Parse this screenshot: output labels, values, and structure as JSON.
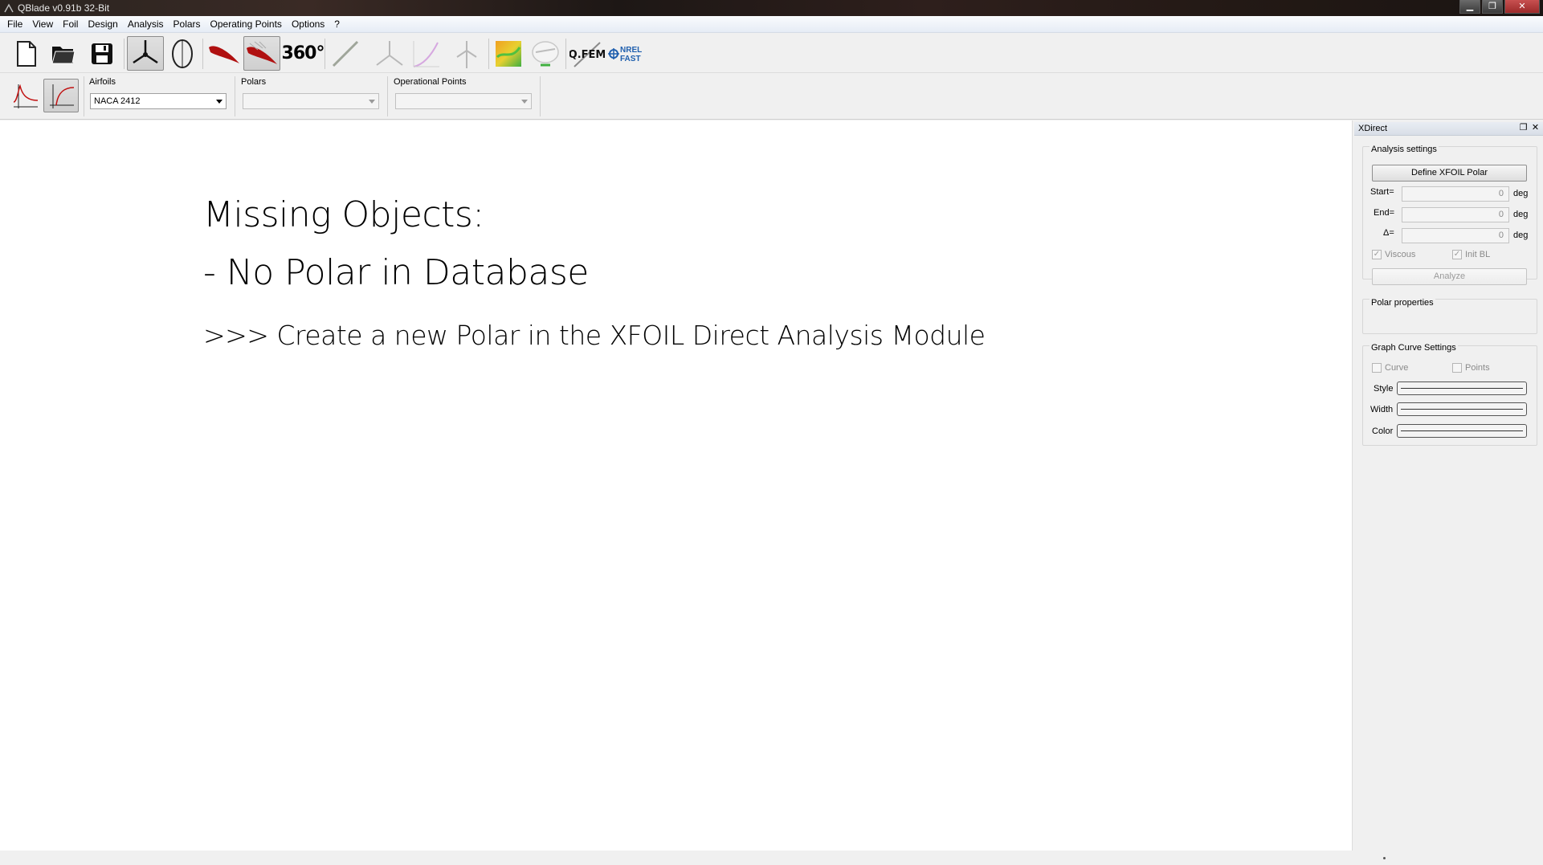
{
  "window": {
    "title": "QBlade v0.91b 32-Bit",
    "controls": [
      "minimize",
      "maximize",
      "close"
    ]
  },
  "menu": [
    "File",
    "View",
    "Foil",
    "Design",
    "Analysis",
    "Polars",
    "Operating Points",
    "Options",
    "?"
  ],
  "toolbar": {
    "items": [
      {
        "name": "new-file-icon"
      },
      {
        "name": "open-folder-icon"
      },
      {
        "name": "save-icon"
      },
      {
        "name": "hawt-rotor-icon",
        "active": true
      },
      {
        "name": "vawt-rotor-icon"
      },
      {
        "name": "airfoil-design-icon"
      },
      {
        "name": "xfoil-direct-icon",
        "active": true
      },
      {
        "name": "polar-360-icon",
        "label": "360°"
      },
      {
        "name": "blade-design-icon"
      },
      {
        "name": "rotor-simulation-icon"
      },
      {
        "name": "multi-parameter-icon"
      },
      {
        "name": "turbine-icon"
      },
      {
        "name": "field-view-icon"
      },
      {
        "name": "characteristic-icon"
      },
      {
        "name": "qfem-icon",
        "label": "Q.FEM"
      },
      {
        "name": "nrel-fast-icon",
        "label_top": "NREL",
        "label_bottom": "FAST"
      }
    ]
  },
  "selectors": {
    "view_buttons": [
      {
        "name": "polar-graph-view-icon"
      },
      {
        "name": "opp-graph-view-icon",
        "active": true
      }
    ],
    "airfoils": {
      "label": "Airfoils",
      "value": "NACA 2412"
    },
    "polars": {
      "label": "Polars",
      "value": ""
    },
    "oppoints": {
      "label": "Operational Points",
      "value": ""
    }
  },
  "message": {
    "line1": "Missing Objects:",
    "line2": "- No Polar in Database",
    "line3": ">>> Create a new Polar in the XFOIL Direct Analysis Module"
  },
  "dock": {
    "title": "XDirect",
    "analysis": {
      "title": "Analysis settings",
      "define_button": "Define XFOIL Polar",
      "start_label": "Start=",
      "start_value": "0",
      "end_label": "End=",
      "end_value": "0",
      "delta_label": "Δ=",
      "delta_value": "0",
      "unit": "deg",
      "viscous_label": "Viscous",
      "initbl_label": "Init BL",
      "analyze_button": "Analyze"
    },
    "polar_properties": {
      "title": "Polar properties"
    },
    "curve_settings": {
      "title": "Graph Curve Settings",
      "curve_label": "Curve",
      "points_label": "Points",
      "style_label": "Style",
      "width_label": "Width",
      "color_label": "Color"
    }
  },
  "colors": {
    "accent_red": "#b01010",
    "nrel_blue": "#1f5fae",
    "canvas": "#ffffff"
  }
}
